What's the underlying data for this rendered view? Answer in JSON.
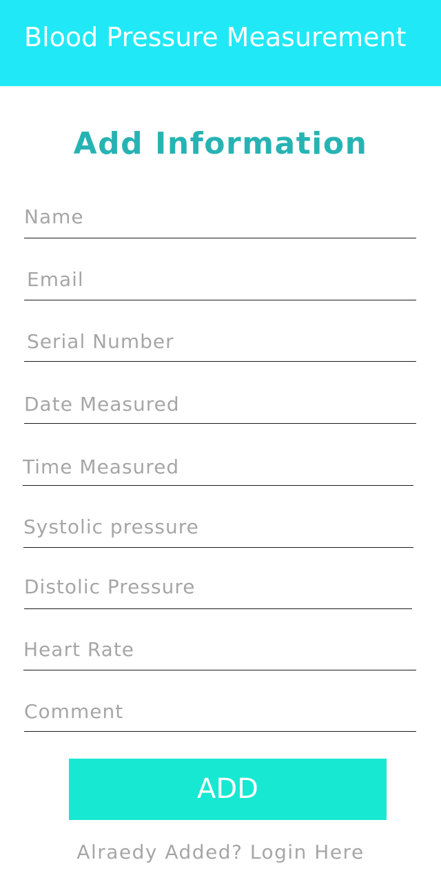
{
  "app_bar": {
    "title": "Blood Pressure Measurement",
    "color": "#21e8f6"
  },
  "form": {
    "heading": "Add Information",
    "heading_color": "#27b3b3",
    "fields": [
      {
        "placeholder": "Name",
        "value": ""
      },
      {
        "placeholder": "Email",
        "value": ""
      },
      {
        "placeholder": "Serial Number",
        "value": ""
      },
      {
        "placeholder": "Date Measured",
        "value": ""
      },
      {
        "placeholder": "Time Measured",
        "value": ""
      },
      {
        "placeholder": "Systolic pressure",
        "value": ""
      },
      {
        "placeholder": "Distolic Pressure",
        "value": ""
      },
      {
        "placeholder": "Heart Rate",
        "value": ""
      },
      {
        "placeholder": "Comment",
        "value": ""
      }
    ],
    "add_button_label": "ADD",
    "add_button_color": "#16e8d2",
    "login_link": "Alraedy Added? Login Here"
  }
}
